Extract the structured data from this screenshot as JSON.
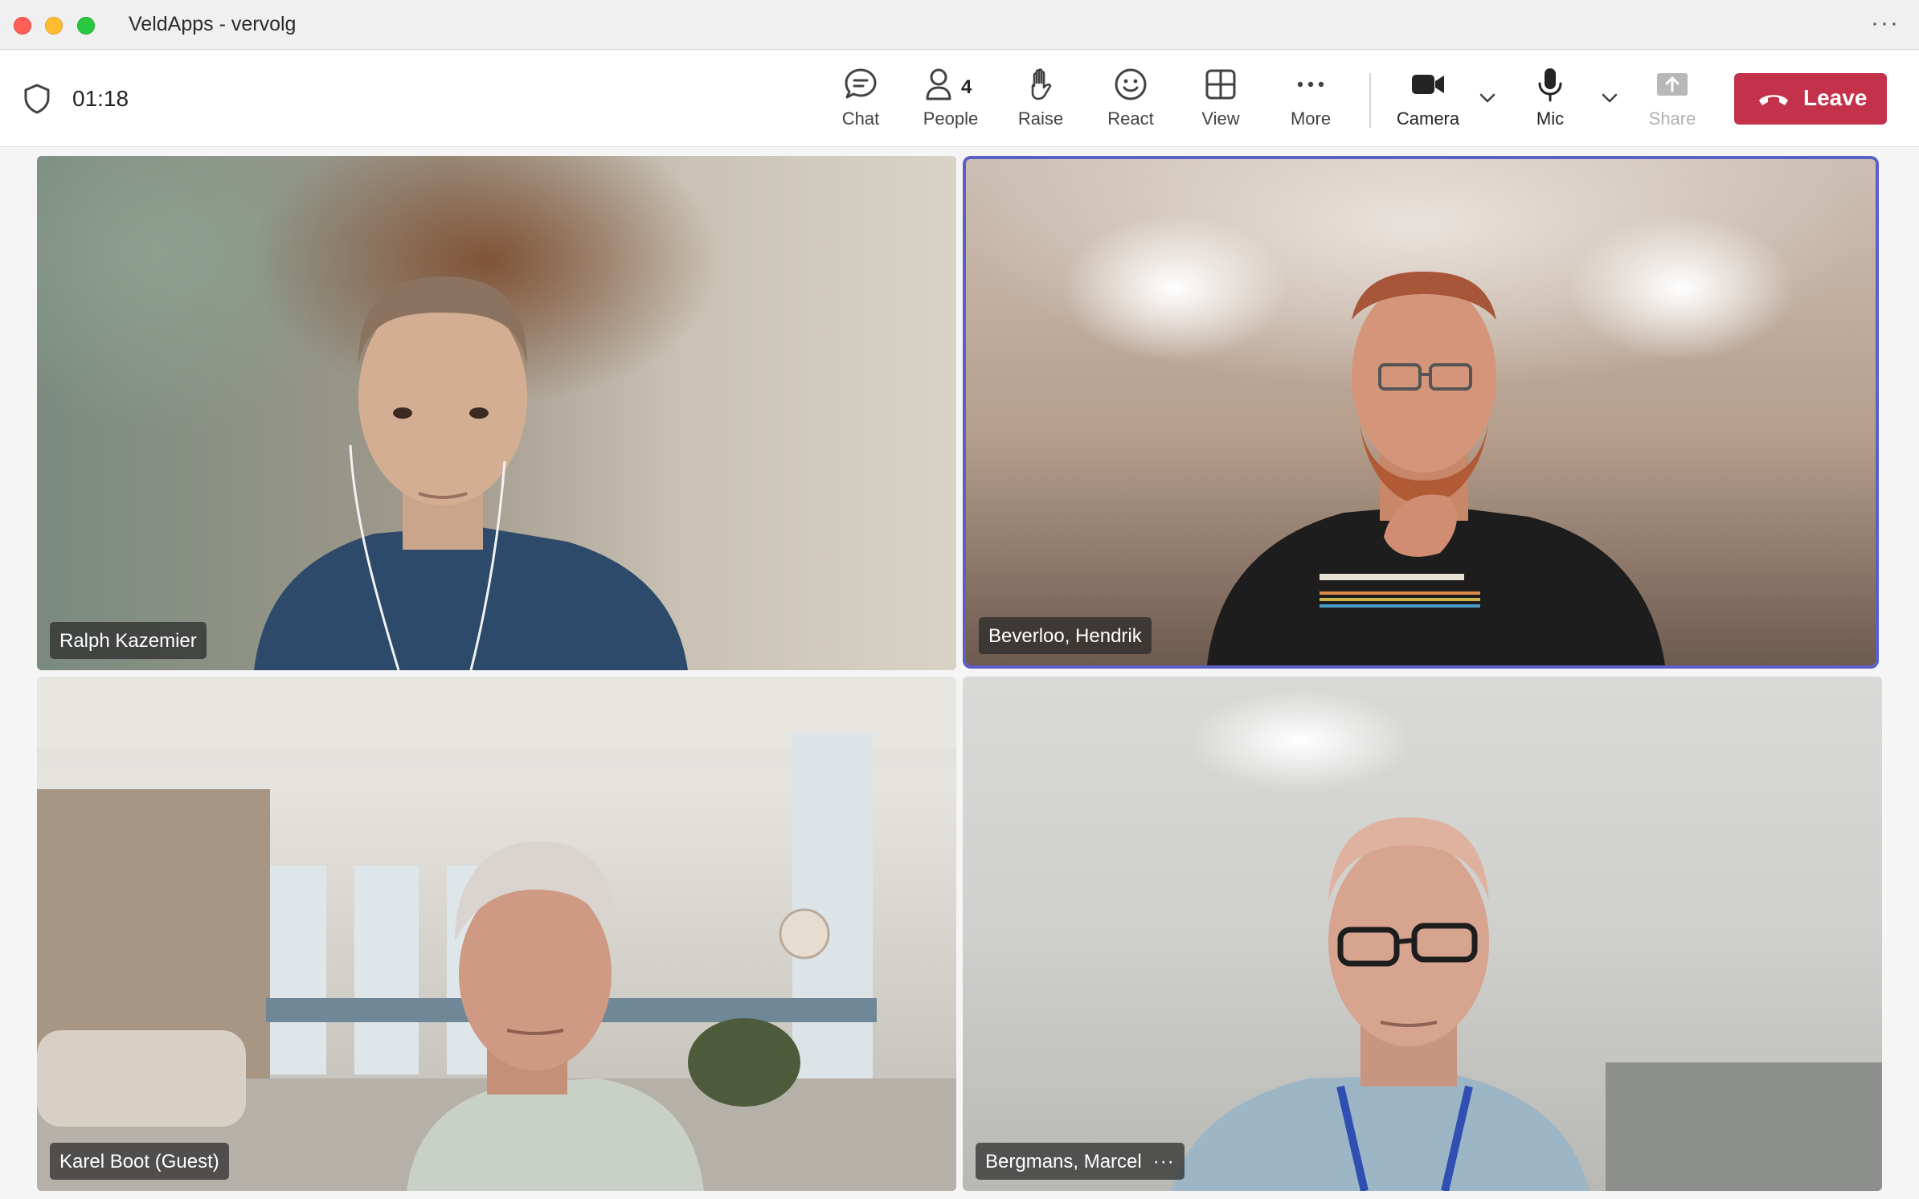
{
  "window": {
    "title": "VeldApps - vervolg",
    "menu": "···"
  },
  "toolbar": {
    "timer": "01:18",
    "buttons": {
      "chat": "Chat",
      "people": "People",
      "people_count": "4",
      "raise": "Raise",
      "react": "React",
      "view": "View",
      "more": "More",
      "camera": "Camera",
      "mic": "Mic",
      "share": "Share",
      "leave": "Leave"
    }
  },
  "participants": [
    {
      "name": "Ralph Kazemier",
      "active_speaker": false
    },
    {
      "name": "Beverloo, Hendrik",
      "active_speaker": true
    },
    {
      "name": "Karel Boot (Guest)",
      "active_speaker": false
    },
    {
      "name": "Bergmans, Marcel",
      "active_speaker": false,
      "more_options": "···"
    }
  ],
  "colors": {
    "leave_button": "#c4314b",
    "active_speaker_border": "#5b5fc7"
  }
}
